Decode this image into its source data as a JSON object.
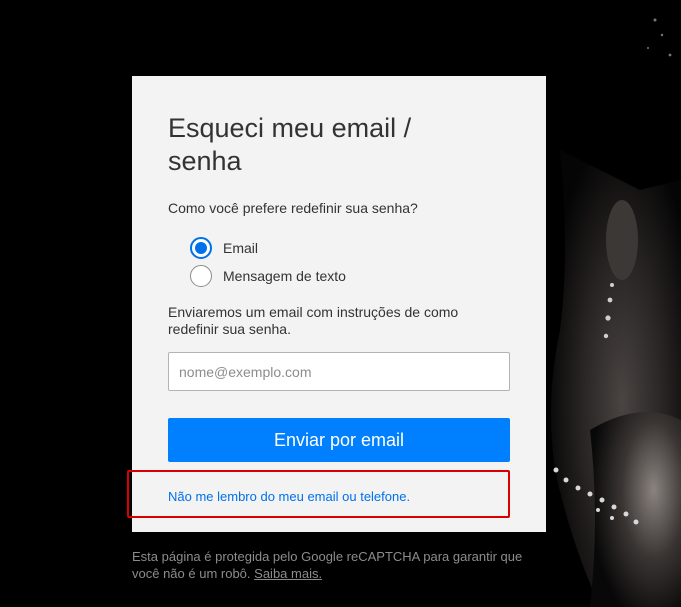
{
  "form": {
    "title": "Esqueci meu email / senha",
    "question": "Como você prefere redefinir sua senha?",
    "options": [
      {
        "label": "Email",
        "selected": true
      },
      {
        "label": "Mensagem de texto",
        "selected": false
      }
    ],
    "info": "Enviaremos um email com instruções de como redefinir sua senha.",
    "email_placeholder": "nome@exemplo.com",
    "email_value": "",
    "submit_label": "Enviar por email",
    "forgot_link": "Não me lembro do meu email ou telefone."
  },
  "footer": {
    "recaptcha_text": "Esta página é protegida pelo Google reCAPTCHA para garantir que você não é um robô.",
    "learn_more": "Saiba mais."
  },
  "colors": {
    "accent": "#0080ff",
    "link": "#0071eb",
    "highlight": "#d80000",
    "card_bg": "#f3f3f3"
  }
}
